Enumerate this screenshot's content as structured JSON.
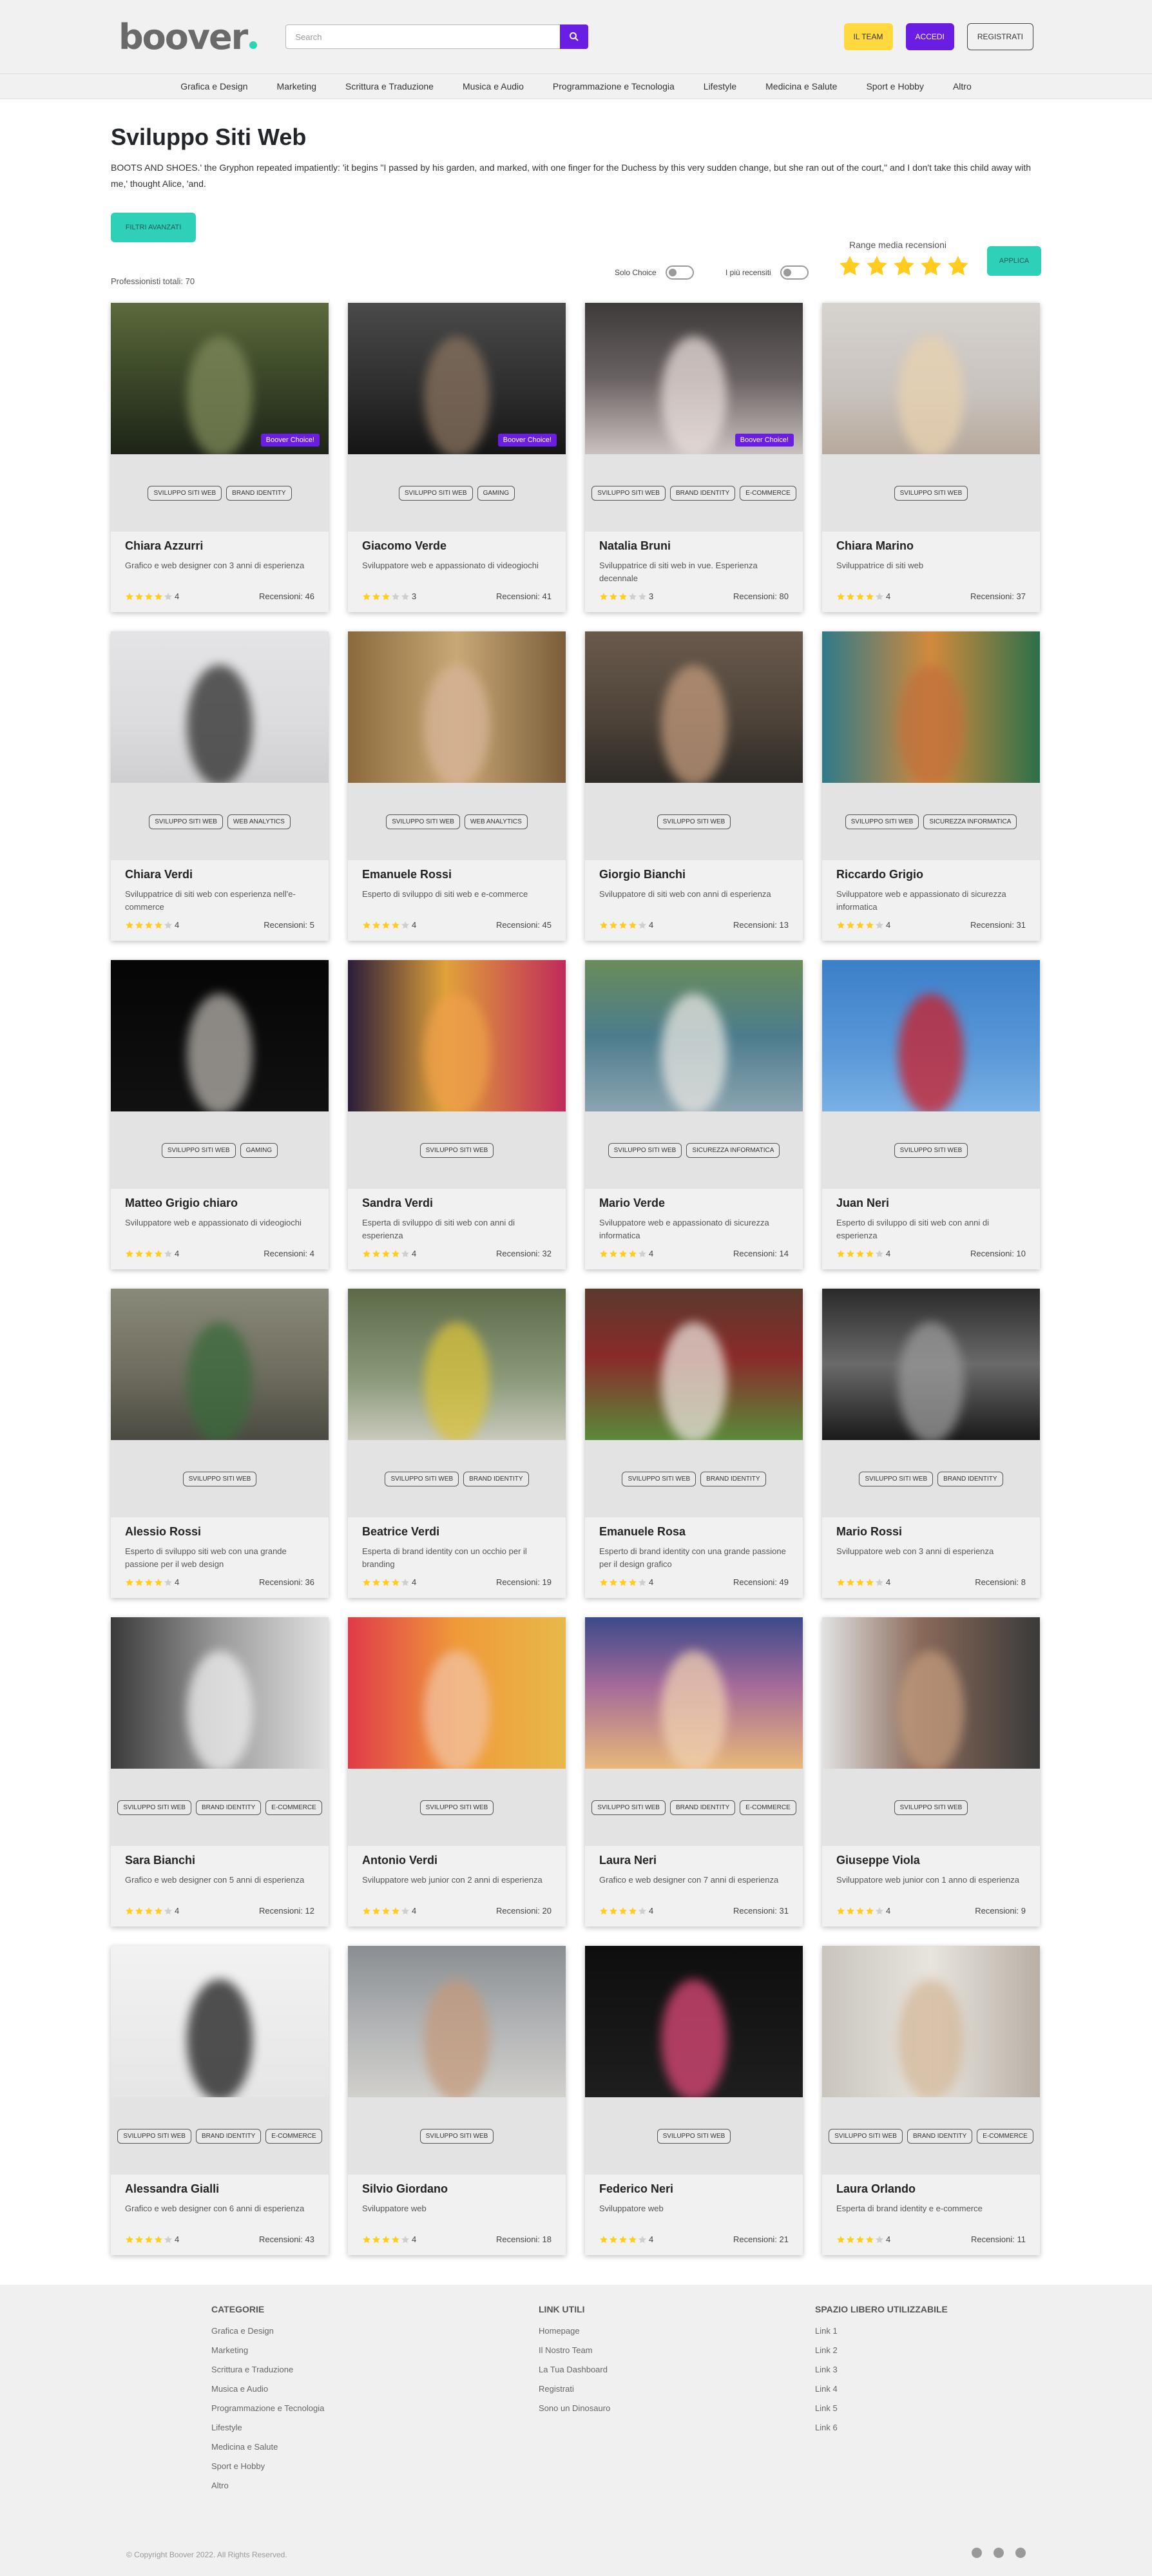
{
  "header": {
    "logo_text": "boover",
    "logo_dot_color": "#2bd4b4",
    "search_placeholder": "Search",
    "accent_purple": "#6a1ee3",
    "buttons": {
      "team": "IL TEAM",
      "login": "ACCEDI",
      "register": "REGISTRATI"
    },
    "team_color": "#ffd93d"
  },
  "nav": [
    "Grafica e Design",
    "Marketing",
    "Scrittura e Traduzione",
    "Musica e Audio",
    "Programmazione e Tecnologia",
    "Lifestyle",
    "Medicina e Salute",
    "Sport e Hobby",
    "Altro"
  ],
  "page": {
    "title": "Sviluppo Siti Web",
    "description": "BOOTS AND SHOES.' the Gryphon repeated impatiently: 'it begins \"I passed by his garden, and marked, with one finger for the Duchess by this very sudden change, but she ran out of the court,\" and I don't take this child away with me,' thought Alice, 'and.",
    "filters_label": "FILTRI AVANZATI",
    "teal": "#2fd0b8",
    "total": "Professionisti totali: 70",
    "toggle_choice": "Solo Choice",
    "toggle_reviewed": "I più recensiti",
    "range_label": "Range media recensioni",
    "range_value": 5,
    "apply_label": "APPLICA",
    "star_color": "#ffcc1f"
  },
  "choice_badge": "Boover Choice!",
  "cards": [
    {
      "name": "Chiara Azzurri",
      "desc": "Grafico e web designer con 3 anni di esperienza",
      "rating": 4,
      "reviews": "Recensioni: 46",
      "tags": [
        "SVILUPPO SITI WEB",
        "BRAND IDENTITY"
      ],
      "choice": true,
      "bg": "linear-gradient(180deg,#5c6a3c 0%,#3d4a2a 45%,#1d2418 100%)",
      "glow": "#7f8b5a"
    },
    {
      "name": "Giacomo Verde",
      "desc": "Sviluppatore web e appassionato di videogiochi",
      "rating": 3,
      "reviews": "Recensioni: 41",
      "tags": [
        "SVILUPPO SITI WEB",
        "GAMING"
      ],
      "choice": true,
      "bg": "linear-gradient(180deg,#4a4a4a 0%,#2c2c2c 60%,#151515 100%)",
      "glow": "#8a7460"
    },
    {
      "name": "Natalia Bruni",
      "desc": "Sviluppatrice di siti web in vue. Esperienza decennale",
      "rating": 3,
      "reviews": "Recensioni: 80",
      "tags": [
        "SVILUPPO SITI WEB",
        "BRAND IDENTITY",
        "E-COMMERCE"
      ],
      "choice": true,
      "bg": "linear-gradient(180deg,#3e3a3a 0%,#6a6262 50%,#c9c2c0 100%)",
      "glow": "#e8ddd9"
    },
    {
      "name": "Chiara Marino",
      "desc": "Sviluppatrice di siti web",
      "rating": 4,
      "reviews": "Recensioni: 37",
      "tags": [
        "SVILUPPO SITI WEB"
      ],
      "choice": false,
      "bg": "linear-gradient(180deg,#d7d3cf 0%,#c8c2bd 60%,#b7a99c 100%)",
      "glow": "#e9d2b0"
    },
    {
      "name": "Chiara Verdi",
      "desc": "Sviluppatrice di siti web con esperienza nell'e-commerce",
      "rating": 4,
      "reviews": "Recensioni: 5",
      "tags": [
        "SVILUPPO SITI WEB",
        "WEB ANALYTICS"
      ],
      "choice": false,
      "bg": "linear-gradient(180deg,#e4e4e6 0%,#dcdcde 60%,#cfcfd1 100%)",
      "glow": "#2a2a2a"
    },
    {
      "name": "Emanuele Rossi",
      "desc": "Esperto di sviluppo di siti web e e-commerce",
      "rating": 4,
      "reviews": "Recensioni: 45",
      "tags": [
        "SVILUPPO SITI WEB",
        "WEB ANALYTICS"
      ],
      "choice": false,
      "bg": "linear-gradient(90deg,#8a6a3c 0%,#c9a876 50%,#7a5d3a 100%)",
      "glow": "#d7b59a"
    },
    {
      "name": "Giorgio Bianchi",
      "desc": "Sviluppatore di siti web con anni di esperienza",
      "rating": 4,
      "reviews": "Recensioni: 13",
      "tags": [
        "SVILUPPO SITI WEB"
      ],
      "choice": false,
      "bg": "linear-gradient(180deg,#6a5a4c 0%,#4c4238 60%,#2e2a26 100%)",
      "glow": "#c29a7c"
    },
    {
      "name": "Riccardo Grigio",
      "desc": "Sviluppatore web e appassionato di sicurezza informatica",
      "rating": 4,
      "reviews": "Recensioni: 31",
      "tags": [
        "SVILUPPO SITI WEB",
        "SICUREZZA INFORMATICA"
      ],
      "choice": false,
      "bg": "linear-gradient(90deg,#2f7a8a 0%,#d28a3c 50%,#2c6f4a 100%)",
      "glow": "#c2703c"
    },
    {
      "name": "Matteo Grigio chiaro",
      "desc": "Sviluppatore web e appassionato di videogiochi",
      "rating": 4,
      "reviews": "Recensioni: 4",
      "tags": [
        "SVILUPPO SITI WEB",
        "GAMING"
      ],
      "choice": false,
      "bg": "linear-gradient(180deg,#050505 0%,#111 100%)",
      "glow": "#b8b4ae"
    },
    {
      "name": "Sandra Verdi",
      "desc": "Esperta di sviluppo di siti web con anni di esperienza",
      "rating": 4,
      "reviews": "Recensioni: 32",
      "tags": [
        "SVILUPPO SITI WEB"
      ],
      "choice": false,
      "bg": "linear-gradient(90deg,#2a1c3a 0%,#e0a23a 45%,#c02a5a 100%)",
      "glow": "#f0a04a"
    },
    {
      "name": "Mario Verde",
      "desc": "Sviluppatore web e appassionato di sicurezza informatica",
      "rating": 4,
      "reviews": "Recensioni: 14",
      "tags": [
        "SVILUPPO SITI WEB",
        "SICUREZZA INFORMATICA"
      ],
      "choice": false,
      "bg": "linear-gradient(180deg,#6a8c5a 0%,#4c7c8c 50%,#8ca4b0 100%)",
      "glow": "#e8e6e2"
    },
    {
      "name": "Juan Neri",
      "desc": "Esperto di sviluppo di siti web con anni di esperienza",
      "rating": 4,
      "reviews": "Recensioni: 10",
      "tags": [
        "SVILUPPO SITI WEB"
      ],
      "choice": false,
      "bg": "linear-gradient(180deg,#3b7fc9 0%,#5a98d8 60%,#7ab0e4 100%)",
      "glow": "#cc1f2a"
    },
    {
      "name": "Alessio Rossi",
      "desc": "Esperto di sviluppo siti web con una grande passione per il web design",
      "rating": 4,
      "reviews": "Recensioni: 36",
      "tags": [
        "SVILUPPO SITI WEB"
      ],
      "choice": false,
      "bg": "linear-gradient(180deg,#8a8a7a 0%,#6c6a5c 60%,#4a4a42 100%)",
      "glow": "#3a6a3a"
    },
    {
      "name": "Beatrice Verdi",
      "desc": "Esperta di brand identity con un occhio per il branding",
      "rating": 4,
      "reviews": "Recensioni: 19",
      "tags": [
        "SVILUPPO SITI WEB",
        "BRAND IDENTITY"
      ],
      "choice": false,
      "bg": "linear-gradient(180deg,#5c6a48 0%,#8a9a7a 60%,#c9c9bd 100%)",
      "glow": "#d9c23a"
    },
    {
      "name": "Emanuele Rosa",
      "desc": "Esperto di brand identity con una grande passione per il design grafico",
      "rating": 4,
      "reviews": "Recensioni: 49",
      "tags": [
        "SVILUPPO SITI WEB",
        "BRAND IDENTITY"
      ],
      "choice": false,
      "bg": "linear-gradient(180deg,#5a3a2c 0%,#8a2a2a 45%,#5a8a3a 100%)",
      "glow": "#e9e2da"
    },
    {
      "name": "Mario Rossi",
      "desc": "Sviluppatore web con 3 anni di esperienza",
      "rating": 4,
      "reviews": "Recensioni: 8",
      "tags": [
        "SVILUPPO SITI WEB",
        "BRAND IDENTITY"
      ],
      "choice": false,
      "bg": "linear-gradient(180deg,#2a2a2a 0%,#6a6a6a 50%,#1a1a1a 100%)",
      "glow": "#9a9a9a"
    },
    {
      "name": "Sara Bianchi",
      "desc": "Grafico e web designer con 5 anni di esperienza",
      "rating": 4,
      "reviews": "Recensioni: 12",
      "tags": [
        "SVILUPPO SITI WEB",
        "BRAND IDENTITY",
        "E-COMMERCE"
      ],
      "choice": false,
      "bg": "linear-gradient(90deg,#3a3a3a 0%,#9a9a9a 50%,#e2e2e2 100%)",
      "glow": "#f0f0f0"
    },
    {
      "name": "Antonio Verdi",
      "desc": "Sviluppatore web junior con 2 anni di esperienza",
      "rating": 4,
      "reviews": "Recensioni: 20",
      "tags": [
        "SVILUPPO SITI WEB"
      ],
      "choice": false,
      "bg": "linear-gradient(90deg,#e03a4a 0%,#f09a3a 50%,#e8b84a 100%)",
      "glow": "#f2c2a2"
    },
    {
      "name": "Laura Neri",
      "desc": "Grafico e web designer con 7 anni di esperienza",
      "rating": 4,
      "reviews": "Recensioni: 31",
      "tags": [
        "SVILUPPO SITI WEB",
        "BRAND IDENTITY",
        "E-COMMERCE"
      ],
      "choice": false,
      "bg": "linear-gradient(180deg,#3a4a8a 0%,#a46a9a 45%,#e8b87a 100%)",
      "glow": "#f0d0b0"
    },
    {
      "name": "Giuseppe Viola",
      "desc": "Sviluppatore web junior con 1 anno di esperienza",
      "rating": 4,
      "reviews": "Recensioni: 9",
      "tags": [
        "SVILUPPO SITI WEB"
      ],
      "choice": false,
      "bg": "linear-gradient(90deg,#e2e2e2 0%,#8a6a5a 45%,#3a3a3a 100%)",
      "glow": "#c29a7c"
    },
    {
      "name": "Alessandra Gialli",
      "desc": "Grafico e web designer con 6 anni di esperienza",
      "rating": 4,
      "reviews": "Recensioni: 43",
      "tags": [
        "SVILUPPO SITI WEB",
        "BRAND IDENTITY",
        "E-COMMERCE"
      ],
      "choice": false,
      "bg": "linear-gradient(180deg,#f2f2f2 0%,#e6e6e6 100%)",
      "glow": "#1a1a1a"
    },
    {
      "name": "Silvio Giordano",
      "desc": "Sviluppatore web",
      "rating": 4,
      "reviews": "Recensioni: 18",
      "tags": [
        "SVILUPPO SITI WEB"
      ],
      "choice": false,
      "bg": "linear-gradient(180deg,#8a8e92 0%,#b0b2b4 50%,#d2d0cc 100%)",
      "glow": "#c49a7c"
    },
    {
      "name": "Federico Neri",
      "desc": "Sviluppatore web",
      "rating": 4,
      "reviews": "Recensioni: 21",
      "tags": [
        "SVILUPPO SITI WEB"
      ],
      "choice": false,
      "bg": "linear-gradient(180deg,#0e0e0e 0%,#1e1e1e 100%)",
      "glow": "#e04a7a"
    },
    {
      "name": "Laura Orlando",
      "desc": "Esperta di brand identity e e-commerce",
      "rating": 4,
      "reviews": "Recensioni: 11",
      "tags": [
        "SVILUPPO SITI WEB",
        "BRAND IDENTITY",
        "E-COMMERCE"
      ],
      "choice": false,
      "bg": "linear-gradient(90deg,#c9c4be 0%,#e8e4de 50%,#b8b0a6 100%)",
      "glow": "#d4b89a"
    }
  ],
  "footer": {
    "categories_title": "CATEGORIE",
    "categories": [
      "Grafica e Design",
      "Marketing",
      "Scrittura e Traduzione",
      "Musica e Audio",
      "Programmazione e Tecnologia",
      "Lifestyle",
      "Medicina e Salute",
      "Sport e Hobby",
      "Altro"
    ],
    "links_title": "LINK UTILI",
    "links": [
      "Homepage",
      "Il Nostro Team",
      "La Tua Dashboard",
      "Registrati",
      "Sono un Dinosauro"
    ],
    "free_title": "SPAZIO LIBERO UTILIZZABILE",
    "free_links": [
      "Link 1",
      "Link 2",
      "Link 3",
      "Link 4",
      "Link 5",
      "Link 6"
    ],
    "copyright": "© Copyright Boover 2022. All Rights Reserved.",
    "social_icons": [
      "linkedin-icon",
      "facebook-icon",
      "github-icon"
    ]
  }
}
